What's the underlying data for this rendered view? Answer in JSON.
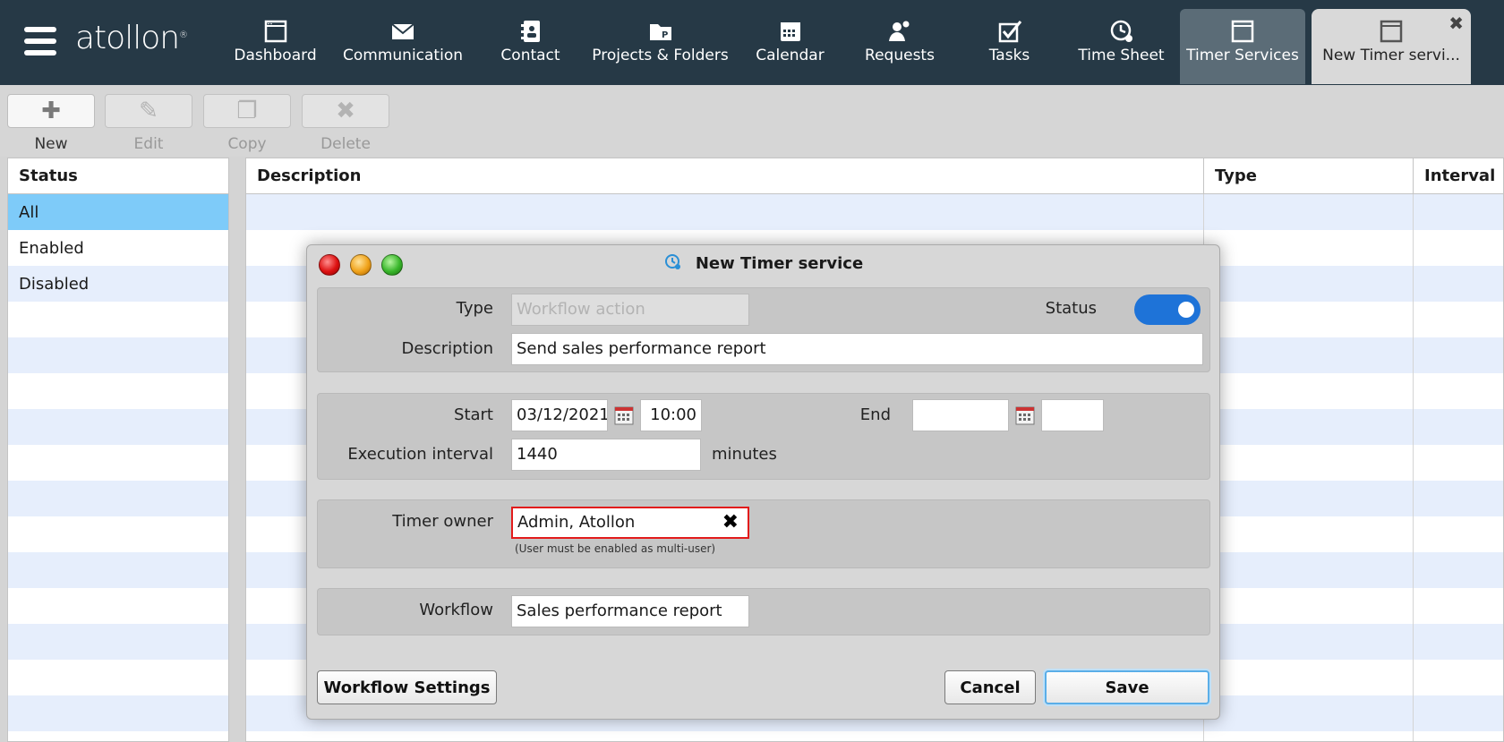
{
  "app": {
    "logo": "atollon",
    "logo_mark": "®"
  },
  "nav": {
    "items": [
      {
        "label": "Dashboard",
        "icon": "window-icon"
      },
      {
        "label": "Communication",
        "icon": "envelope-icon"
      },
      {
        "label": "Contact",
        "icon": "address-book-icon"
      },
      {
        "label": "Projects & Folders",
        "icon": "folder-icon"
      },
      {
        "label": "Calendar",
        "icon": "calendar-icon"
      },
      {
        "label": "Requests",
        "icon": "people-icon"
      },
      {
        "label": "Tasks",
        "icon": "checkbox-icon"
      },
      {
        "label": "Time Sheet",
        "icon": "clock-icon"
      },
      {
        "label": "Timer Services",
        "icon": "window-icon"
      }
    ],
    "open_tab": {
      "label": "New Timer servi...",
      "close": "✖"
    }
  },
  "toolbar": {
    "new": "New",
    "edit": "Edit",
    "copy": "Copy",
    "delete": "Delete"
  },
  "status_panel": {
    "header": "Status",
    "items": [
      "All",
      "Enabled",
      "Disabled"
    ],
    "selected": "All"
  },
  "grid": {
    "columns": [
      "Description",
      "Type",
      "Interval"
    ]
  },
  "dialog": {
    "title": "New Timer service",
    "type_label": "Type",
    "type_value": "Workflow action",
    "status_label": "Status",
    "status_on": true,
    "description_label": "Description",
    "description_value": "Send sales performance report",
    "start_label": "Start",
    "start_date": "03/12/2021",
    "start_time": "10:00",
    "end_label": "End",
    "end_date": "",
    "end_time": "",
    "interval_label": "Execution interval",
    "interval_value": "1440",
    "interval_unit": "minutes",
    "owner_label": "Timer owner",
    "owner_value": "Admin, Atollon",
    "owner_hint": "(User must be enabled as multi-user)",
    "workflow_label": "Workflow",
    "workflow_value": "Sales performance report",
    "btn_workflow_settings": "Workflow Settings",
    "btn_cancel": "Cancel",
    "btn_save": "Save"
  },
  "colors": {
    "topbar": "#263946",
    "selected_row": "#7ecbf9",
    "stripe": "#e6eefc",
    "toggle": "#1e73d8",
    "error_border": "#e21b1b"
  }
}
